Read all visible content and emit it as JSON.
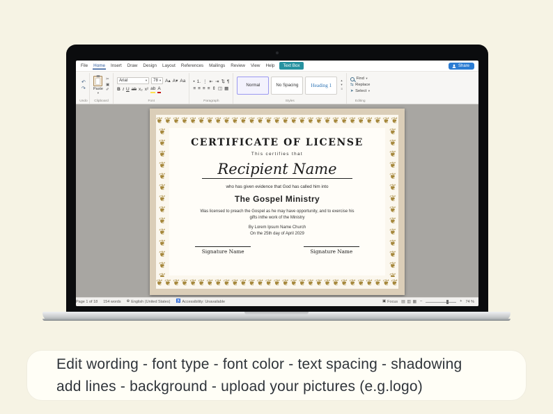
{
  "colors": {
    "background_cream": "#f6f3e4",
    "share_blue": "#2b7cd3",
    "contextual_tab_teal": "#2792a0",
    "active_tab_blue": "#2b579a",
    "heading_style_blue": "#2e74b5",
    "ornament_gold": "#a5873b",
    "canvas_gray": "#a8a6a2",
    "page_tan": "#dbceb8"
  },
  "menu": {
    "tabs": [
      "File",
      "Home",
      "Insert",
      "Draw",
      "Design",
      "Layout",
      "References",
      "Mailings",
      "Review",
      "View",
      "Help"
    ],
    "contextual_tab": "Text Box",
    "share_label": "Share"
  },
  "ribbon": {
    "group_labels": [
      "Undo",
      "Clipboard",
      "Font",
      "Paragraph",
      "Styles",
      "Editing"
    ],
    "paste_label": "Paste",
    "font_name": "Arial",
    "font_size": "78",
    "style_gallery": [
      "Normal",
      "No Spacing",
      "Heading 1"
    ],
    "editing_items": [
      "Find",
      "Replace",
      "Select"
    ],
    "icons": {
      "undo": "↶",
      "redo": "↷",
      "caret": "▾",
      "scissors": "✂",
      "copy": "▣",
      "format_painter": "✐",
      "grow_font": "A▴",
      "shrink_font": "A▾",
      "change_case": "Aa",
      "bold": "B",
      "italic": "I",
      "underline": "U",
      "strikethrough": "ab",
      "subscript": "x₂",
      "superscript": "x²",
      "highlight": "ab",
      "font_color": "A",
      "bullets": "•",
      "numbering": "1.",
      "multilevel": "⋮",
      "outdent": "⇤",
      "indent": "⇥",
      "sort": "⇅",
      "pilcrow": "¶",
      "align_left": "≡",
      "align_center": "≡",
      "align_right": "≡",
      "justify": "≡",
      "line_spacing": "⇕",
      "shading": "◫",
      "borders": "▦",
      "scroll_up": "▴",
      "scroll_down": "▾",
      "gallery_more": "≡",
      "replace": "⇆",
      "select": "➤"
    }
  },
  "certificate": {
    "title": "CERTIFICATE OF LICENSE",
    "tagline": "This certifies that",
    "recipient_name": "Recipient Name",
    "evidence_line": "who has given evidence that God has called him into",
    "ministry_line": "The Gospel Ministry",
    "body_line1": "Was licensed to preach the Gospel as he may have opportunity, and to exercise his",
    "body_line2": "gifts inthe work of the Ministry",
    "church_line": "By Lorem Ipsum Name Church",
    "date_line": "On the 25th day of April 2029",
    "signature_left": "Signature Name",
    "signature_right": "Signature Name"
  },
  "ornament": {
    "glyph": "❦",
    "color": "#a5873b"
  },
  "status": {
    "page_indicator": "Page 1 of 18",
    "word_count": "154 words",
    "language": "English (United States)",
    "accessibility": "Accessibility: Unavailable",
    "focus_label": "Focus",
    "zoom_level": "74 %",
    "icons": {
      "language": "⊕",
      "accessibility": "♿",
      "focus": "▣",
      "view_read": "▤",
      "view_print": "▥",
      "view_web": "▦",
      "zoom_out": "–",
      "zoom_in": "+"
    }
  },
  "caption": {
    "line1": "Edit wording - font type - font color - text spacing - shadowing",
    "line2": "add lines - background -  upload your pictures (e.g.logo)"
  }
}
